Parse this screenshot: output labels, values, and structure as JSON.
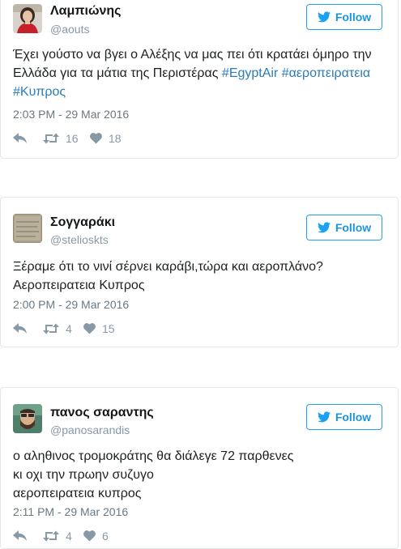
{
  "tweets": [
    {
      "name": "Λαμπιώνης",
      "handle": "@aouts",
      "follow_label": "Follow",
      "text": "Έχει γούστο να βγει ο Αλέξης να μας πει ότι κρατάει όμηρο την",
      "line2_text": "Ελλάδα για τα μάτια της Περιστέρας",
      "hashtag1": "#EgyptAir",
      "hashtag2": "#αεροπειρατεια",
      "hashtag3": "#Κυπρος",
      "time": "2:03 PM - 29 Mar 2016",
      "retweets": "16",
      "likes": "18"
    },
    {
      "name": "Σογγαράκι",
      "handle": "@stelioskts",
      "follow_label": "Follow",
      "line1": "Ξέραμε ότι το νινί σέρνει καράβι,τώρα και αεροπλάνο?",
      "line2": "Αεροπειρατεια Κυπρος",
      "time": "2:00 PM - 29 Mar 2016",
      "retweets": "4",
      "likes": "15"
    },
    {
      "name": "πανος σαραντης",
      "handle": "@panosarandis",
      "follow_label": "Follow",
      "line1": "ο αληθινος τρομοκράτης θα διάλεγε 72 παρθενες",
      "line2": "κι οχι την πρωην συζυγο",
      "line3": "αεροπειρατεια κυπρος",
      "time": "2:11 PM - 29 Mar 2016",
      "retweets": "4",
      "likes": "6"
    }
  ],
  "colors": {
    "link": "#2b7bb9",
    "follow_blue": "#1da1f2",
    "meta_gray": "#8899a6",
    "border": "#e1e8ed"
  }
}
